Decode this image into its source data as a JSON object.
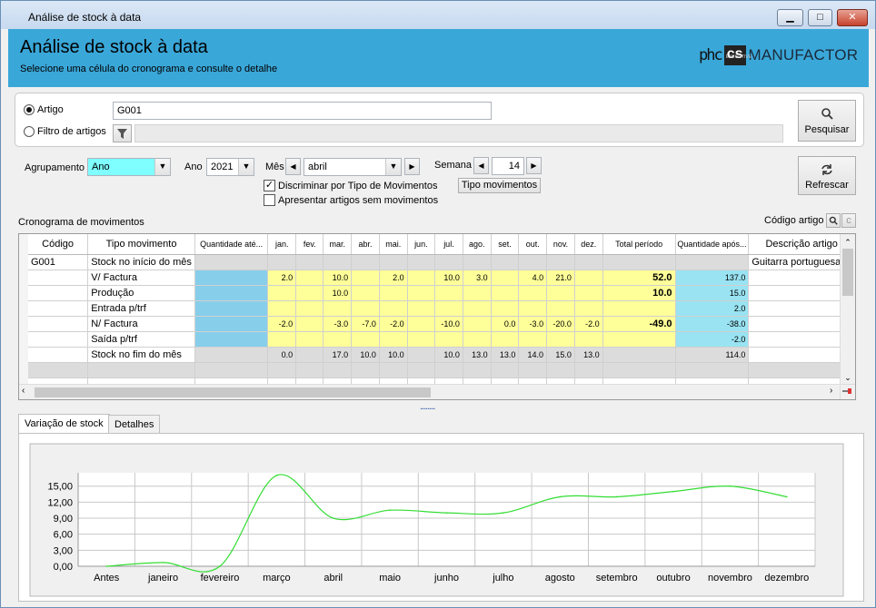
{
  "window": {
    "title": "Análise de stock à data",
    "min": "▁",
    "max": "□",
    "close": "✕"
  },
  "header": {
    "title": "Análise de stock à data",
    "subtitle": "Selecione uma célula do cronograma e consulte o detalhe"
  },
  "logo": {
    "phc": "phc",
    "cs": "cs",
    "cs_small": "EXECUTIVE",
    "manufactor": "MANUFACTOR"
  },
  "filter": {
    "artigo_label": "Artigo",
    "artigo_value": "G001",
    "filtro_label": "Filtro de artigos",
    "filtro_value": "",
    "search_button": "Pesquisar"
  },
  "options": {
    "agrupamento_label": "Agrupamento",
    "agrupamento_value": "Ano",
    "ano_label": "Ano",
    "ano_value": "2021",
    "mes_label": "Mês",
    "mes_value": "abril",
    "semana_label": "Semana",
    "semana_value": "14",
    "discriminar_label": "Discriminar por Tipo de Movimentos",
    "apresentar_label": "Apresentar artigos sem movimentos",
    "tipo_mov_button": "Tipo movimentos",
    "refresh_button": "Refrescar"
  },
  "grid": {
    "section_label": "Cronograma de movimentos",
    "codigo_artigo_label": "Código artigo",
    "filter_c": "c",
    "columns": [
      "Código",
      "Tipo movimento",
      "Quantidade até...",
      "jan.",
      "fev.",
      "mar.",
      "abr.",
      "mai.",
      "jun.",
      "jul.",
      "ago.",
      "set.",
      "out.",
      "nov.",
      "dez.",
      "Total período",
      "Quantidade após...",
      "Descrição artigo"
    ],
    "rows": [
      {
        "codigo": "G001",
        "tipo": "Stock no início do mês",
        "ate": "",
        "m": [
          "",
          "",
          "",
          "",
          "",
          "",
          "",
          "",
          "",
          "",
          "",
          ""
        ],
        "total": "",
        "apos": "",
        "desc": "Guitarra portuguesa",
        "style": "gray"
      },
      {
        "codigo": "",
        "tipo": "V/ Factura",
        "ate": "",
        "m": [
          "2.0",
          "",
          "10.0",
          "",
          "2.0",
          "",
          "10.0",
          "3.0",
          "",
          "4.0",
          "21.0",
          ""
        ],
        "total": "52.0",
        "apos": "137.0",
        "desc": "",
        "style": "yellow"
      },
      {
        "codigo": "",
        "tipo": "Produção",
        "ate": "",
        "m": [
          "",
          "",
          "10.0",
          "",
          "",
          "",
          "",
          "",
          "",
          "",
          "",
          ""
        ],
        "total": "10.0",
        "apos": "15.0",
        "desc": "",
        "style": "yellow"
      },
      {
        "codigo": "",
        "tipo": "Entrada p/trf",
        "ate": "",
        "m": [
          "",
          "",
          "",
          "",
          "",
          "",
          "",
          "",
          "",
          "",
          "",
          ""
        ],
        "total": "",
        "apos": "2.0",
        "desc": "",
        "style": "yellow"
      },
      {
        "codigo": "",
        "tipo": "N/ Factura",
        "ate": "",
        "m": [
          "-2.0",
          "",
          "-3.0",
          "-7.0",
          "-2.0",
          "",
          "-10.0",
          "",
          "0.0",
          "-3.0",
          "-20.0",
          "-2.0"
        ],
        "total": "-49.0",
        "apos": "-38.0",
        "desc": "",
        "style": "yellow"
      },
      {
        "codigo": "",
        "tipo": "Saída p/trf",
        "ate": "",
        "m": [
          "",
          "",
          "",
          "",
          "",
          "",
          "",
          "",
          "",
          "",
          "",
          ""
        ],
        "total": "",
        "apos": "-2.0",
        "desc": "",
        "style": "yellow"
      },
      {
        "codigo": "",
        "tipo": "Stock no fim do mês",
        "ate": "",
        "m": [
          "0.0",
          "",
          "17.0",
          "10.0",
          "10.0",
          "",
          "10.0",
          "13.0",
          "13.0",
          "14.0",
          "15.0",
          "13.0"
        ],
        "total": "",
        "apos": "114.0",
        "desc": "",
        "style": "gray"
      }
    ]
  },
  "splitter": "........",
  "tabs": [
    "Variação de stock",
    "Detalhes"
  ],
  "chart_data": {
    "type": "line",
    "categories": [
      "Antes",
      "janeiro",
      "fevereiro",
      "março",
      "abril",
      "maio",
      "junho",
      "julho",
      "agosto",
      "setembro",
      "outubro",
      "novembro",
      "dezembro"
    ],
    "series": [
      {
        "values": [
          0.0,
          0.7,
          0.0,
          17.0,
          9.0,
          10.5,
          10.0,
          10.0,
          13.0,
          13.0,
          14.0,
          15.0,
          13.0
        ],
        "color": "#33dd33"
      }
    ],
    "yticks": [
      "15,00",
      "12,00",
      "9,00",
      "6,00",
      "3,00",
      "0,00"
    ],
    "ylim": [
      0,
      17.5
    ],
    "grid": true,
    "colors": {
      "grid": "#c8c8c8",
      "plot_bg": "#ffffff",
      "frame_bg": "#f0f0f0"
    }
  },
  "colors": {
    "header": "#3aa7d9",
    "yellow": "#ffff99",
    "cyan": "#87ceeb",
    "combo_cyan": "#7fffff"
  }
}
